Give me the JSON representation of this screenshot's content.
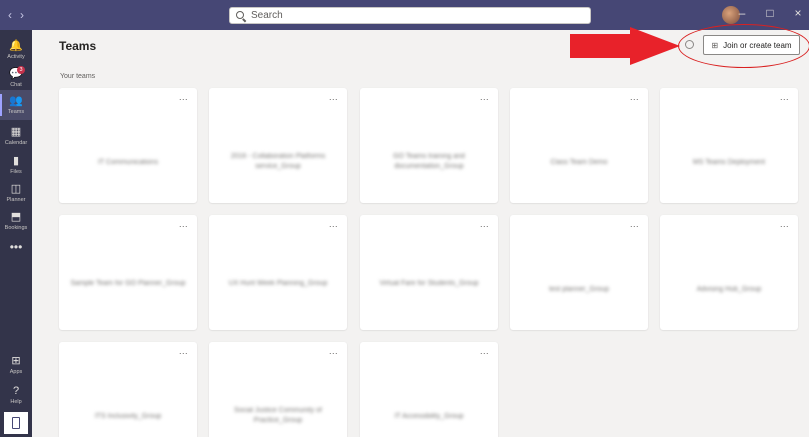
{
  "titlebar": {
    "nav_back": "‹",
    "nav_forward": "›",
    "search_placeholder": "Search",
    "window_minimize": "–",
    "window_maximize": "□",
    "window_close": "×"
  },
  "rail": {
    "items": [
      {
        "label": "Activity",
        "icon": "bell-icon",
        "glyph": "🔔"
      },
      {
        "label": "Chat",
        "icon": "chat-icon",
        "glyph": "💬",
        "badge": "3"
      },
      {
        "label": "Teams",
        "icon": "teams-icon",
        "glyph": "👥",
        "active": true
      },
      {
        "label": "Calendar",
        "icon": "calendar-icon",
        "glyph": "▦"
      },
      {
        "label": "Files",
        "icon": "files-icon",
        "glyph": "▮"
      },
      {
        "label": "Planner",
        "icon": "planner-icon",
        "glyph": "◫"
      },
      {
        "label": "Bookings",
        "icon": "bookings-icon",
        "glyph": "⬒"
      }
    ],
    "more": "•••",
    "apps_label": "Apps",
    "apps_glyph": "⊞",
    "help_label": "Help",
    "help_glyph": "?"
  },
  "header": {
    "title": "Teams",
    "join_button": "Join or create team"
  },
  "section_label": "Your teams",
  "teams": [
    {
      "name": "IT Communications"
    },
    {
      "name": "2016 - Collaboration Platforms service_Group"
    },
    {
      "name": "GO Teams training and documentation_Group"
    },
    {
      "name": "Class Team Demo"
    },
    {
      "name": "MS Teams Deployment"
    },
    {
      "name": "Sample Team for GO Planner_Group"
    },
    {
      "name": "UX Hunt Week Planning_Group"
    },
    {
      "name": "Virtual Fare for Students_Group"
    },
    {
      "name": "test planner_Group"
    },
    {
      "name": "Advising Hub_Group"
    },
    {
      "name": "ITS Inclusivity_Group"
    },
    {
      "name": "Social Justice Community of Practice_Group"
    },
    {
      "name": "IT Accessibility_Group"
    }
  ],
  "card_more": "...",
  "colors": {
    "titlebar": "#464775",
    "rail": "#33344a",
    "accent": "#9ea2ff",
    "annotation": "#e8222a"
  }
}
